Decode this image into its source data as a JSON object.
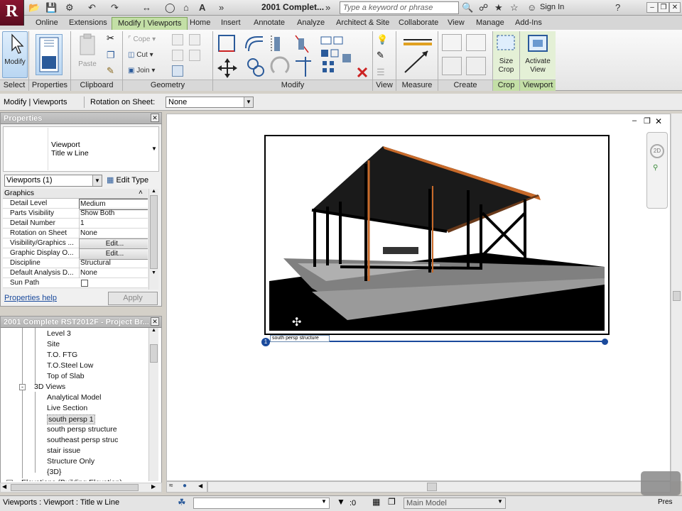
{
  "title_bar": {
    "app_logo": "R",
    "document_title": "2001 Complet...",
    "search_placeholder": "Type a keyword or phrase",
    "sign_in": "Sign In",
    "help": "?"
  },
  "tabs": [
    "Online",
    "Extensions",
    "Modify | Viewports",
    "Home",
    "Insert",
    "Annotate",
    "Analyze",
    "Architect & Site",
    "Collaborate",
    "View",
    "Manage",
    "Add-Ins"
  ],
  "ribbon": {
    "modify_label": "Modify",
    "paste_label": "Paste",
    "cope_label": "Cope",
    "cut_label": "Cut",
    "join_label": "Join",
    "size_crop_label": "Size\nCrop",
    "activate_view_label": "Activate\nView",
    "panels": {
      "select": "Select",
      "properties": "Properties",
      "clipboard": "Clipboard",
      "geometry": "Geometry",
      "modify": "Modify",
      "view": "View",
      "measure": "Measure",
      "create": "Create",
      "crop": "Crop",
      "viewport": "Viewport"
    }
  },
  "options_bar": {
    "context": "Modify | Viewports",
    "rotation_label": "Rotation on Sheet:",
    "rotation_value": "None"
  },
  "properties": {
    "title": "Properties",
    "type_name_line1": "Viewport",
    "type_name_line2": "Title w Line",
    "instance_filter": "Viewports (1)",
    "edit_type": "Edit Type",
    "section": "Graphics",
    "rows": [
      {
        "name": "Detail Level",
        "value": "Medium"
      },
      {
        "name": "Parts Visibility",
        "value": "Show Both"
      },
      {
        "name": "Detail Number",
        "value": "1"
      },
      {
        "name": "Rotation on Sheet",
        "value": "None"
      },
      {
        "name": "Visibility/Graphics ...",
        "value": "Edit..."
      },
      {
        "name": "Graphic Display O...",
        "value": "Edit..."
      },
      {
        "name": "Discipline",
        "value": "Structural"
      },
      {
        "name": "Default Analysis D...",
        "value": "None"
      },
      {
        "name": "Sun Path",
        "value": ""
      }
    ],
    "help_link": "Properties help",
    "apply_button": "Apply"
  },
  "project_browser": {
    "title": "2001 Complete RST2012F - Project Br...",
    "items": [
      {
        "label": "Level 3",
        "indent": 3
      },
      {
        "label": "Site",
        "indent": 3
      },
      {
        "label": "T.O. FTG",
        "indent": 3
      },
      {
        "label": "T.O.Steel Low",
        "indent": 3
      },
      {
        "label": "Top of Slab",
        "indent": 3
      },
      {
        "label": "3D Views",
        "indent": 2
      },
      {
        "label": "Analytical Model",
        "indent": 3
      },
      {
        "label": "Live Section",
        "indent": 3
      },
      {
        "label": "south persp 1",
        "indent": 3,
        "selected": true
      },
      {
        "label": "south persp structure",
        "indent": 3
      },
      {
        "label": "southeast persp struc",
        "indent": 3
      },
      {
        "label": "stair issue",
        "indent": 3
      },
      {
        "label": "Structure Only",
        "indent": 3
      },
      {
        "label": "{3D}",
        "indent": 3
      },
      {
        "label": "Elevations (Building Elevation)",
        "indent": 1
      }
    ]
  },
  "viewport": {
    "title_tag_number": "1",
    "title_text": "south persp structure"
  },
  "status_bar": {
    "text": "Viewports : Viewport : Title w Line",
    "selection_count": ":0",
    "workset": "Main Model",
    "press_text": "Pres"
  },
  "colors": {
    "accent_blue": "#1a4a9c",
    "active_tab_green": "#c3dfa6",
    "logo_red": "#8a1530",
    "roof_edge": "#c86a2a"
  }
}
